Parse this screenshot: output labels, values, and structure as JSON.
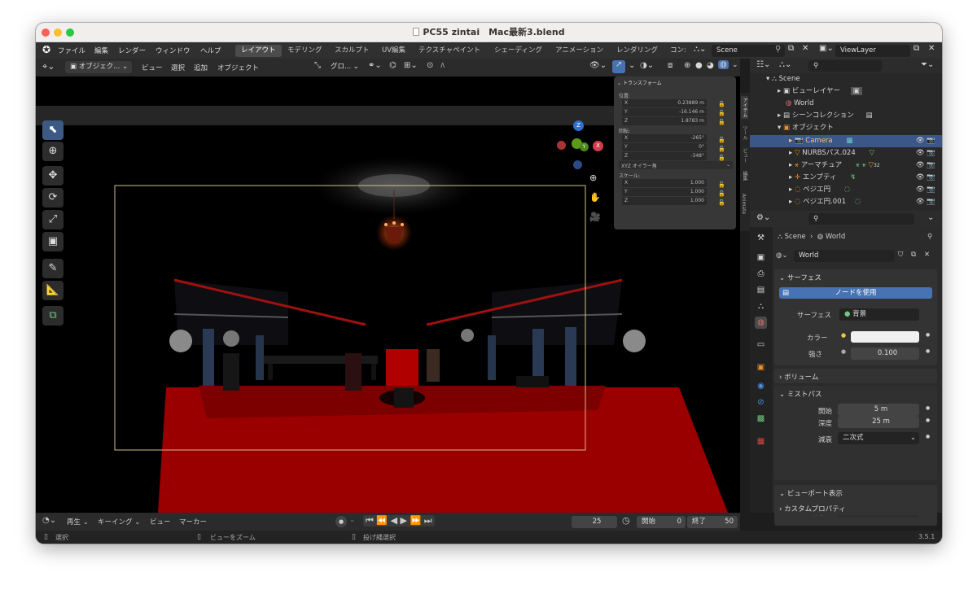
{
  "window": {
    "title": "PC55 zintai　Mac最新3.blend"
  },
  "menubar": {
    "menus": [
      "ファイル",
      "編集",
      "レンダー",
      "ウィンドウ",
      "ヘルプ"
    ],
    "workspaces": [
      "レイアウト",
      "モデリング",
      "スカルプト",
      "UV編集",
      "テクスチャペイント",
      "シェーディング",
      "アニメーション",
      "レンダリング",
      "コン:"
    ],
    "scene": "Scene",
    "view_layer": "ViewLayer"
  },
  "viewport_header": {
    "mode": "オブジェク...",
    "menus": [
      "ビュー",
      "選択",
      "追加",
      "オブジェクト"
    ],
    "orientation": "グロ...",
    "options": "オプション"
  },
  "transform_panel": {
    "title": "トランスフォーム",
    "location_label": "位置:",
    "location": [
      {
        "axis": "X",
        "value": "0.23889 m"
      },
      {
        "axis": "Y",
        "value": "-16.146 m"
      },
      {
        "axis": "Z",
        "value": "1.8783 m"
      }
    ],
    "rotation_label": "回転:",
    "rotation": [
      {
        "axis": "X",
        "value": "-265°"
      },
      {
        "axis": "Y",
        "value": "0°"
      },
      {
        "axis": "Z",
        "value": "-348°"
      }
    ],
    "rotation_mode": "XYZ オイラー角",
    "scale_label": "スケール:",
    "scale": [
      {
        "axis": "X",
        "value": "1.000"
      },
      {
        "axis": "Y",
        "value": "1.000"
      },
      {
        "axis": "Z",
        "value": "1.000"
      }
    ]
  },
  "side_tabs": [
    "アイテム",
    "ツール",
    "ビュー",
    "編集",
    "Animate"
  ],
  "gizmo": {
    "z": "Z",
    "y": "Y",
    "x": "X"
  },
  "outliner": {
    "items": [
      {
        "label": "Scene"
      },
      {
        "label": "ビューレイヤー"
      },
      {
        "label": "World"
      },
      {
        "label": "シーンコレクション"
      },
      {
        "label": "オブジェクト"
      },
      {
        "label": "Camera"
      },
      {
        "label": "NURBSパス.024"
      },
      {
        "label": "アーマチュア"
      },
      {
        "label": "エンプティ"
      },
      {
        "label": "ベジエ円"
      },
      {
        "label": "ベジエ円.001"
      }
    ],
    "armature_count": "32"
  },
  "properties": {
    "breadcrumb_scene": "Scene",
    "breadcrumb_world": "World",
    "world_name": "World",
    "surface_section": "サーフェス",
    "use_nodes": "ノードを使用",
    "surface_label": "サーフェス",
    "surface_value": "背景",
    "color_label": "カラー",
    "strength_label": "強さ",
    "strength_value": "0.100",
    "volume_section": "ボリューム",
    "mist_section": "ミストパス",
    "start_label": "開始",
    "start_value": "5 m",
    "depth_label": "深度",
    "depth_value": "25 m",
    "falloff_label": "減衰",
    "falloff_value": "二次式",
    "viewport_section": "ビューポート表示",
    "vp_color_label": "カラー",
    "custom_section": "カスタムプロパティ"
  },
  "timeline": {
    "play": "再生",
    "keying": "キーイング",
    "view": "ビュー",
    "marker": "マーカー",
    "current_frame": "25",
    "start_label": "開始",
    "start": "0",
    "end_label": "終了",
    "end": "50"
  },
  "statusbar": {
    "select": "選択",
    "zoom": "ビューをズーム",
    "lasso": "投げ縄選択",
    "version": "3.5.1"
  },
  "colors": {
    "accent": "#4772b3",
    "selection": "#3b5789",
    "object_orange": "#e8912f",
    "carpet_red": "#9a0000"
  }
}
